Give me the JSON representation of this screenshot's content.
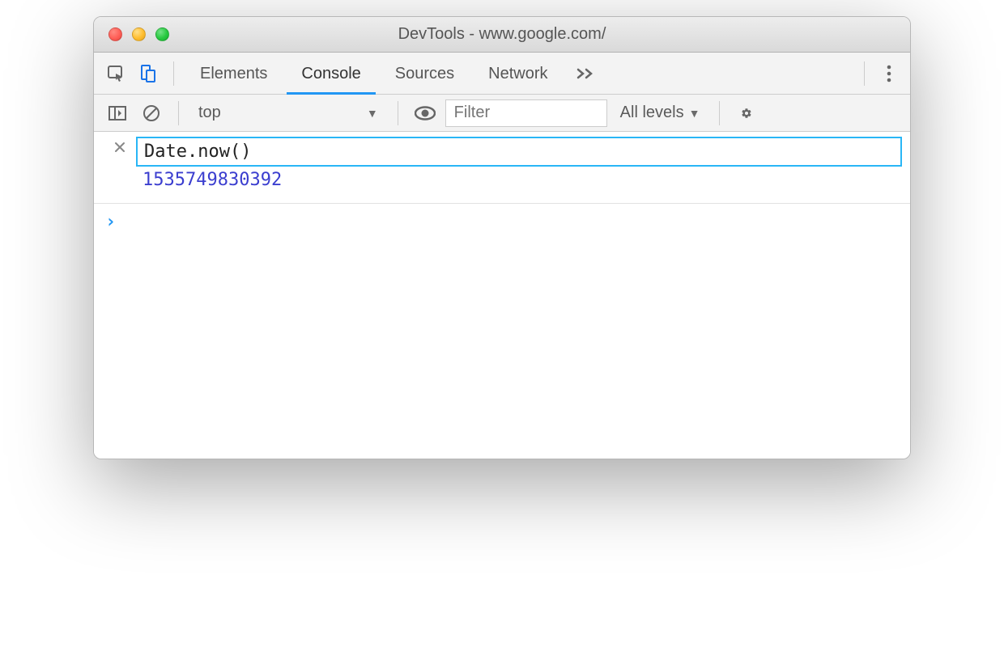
{
  "window": {
    "title": "DevTools - www.google.com/"
  },
  "tabs": {
    "elements": "Elements",
    "console": "Console",
    "sources": "Sources",
    "network": "Network"
  },
  "toolbar": {
    "context": "top",
    "filter_placeholder": "Filter",
    "levels_label": "All levels"
  },
  "console": {
    "expression": "Date.now()",
    "result": "1535749830392"
  }
}
